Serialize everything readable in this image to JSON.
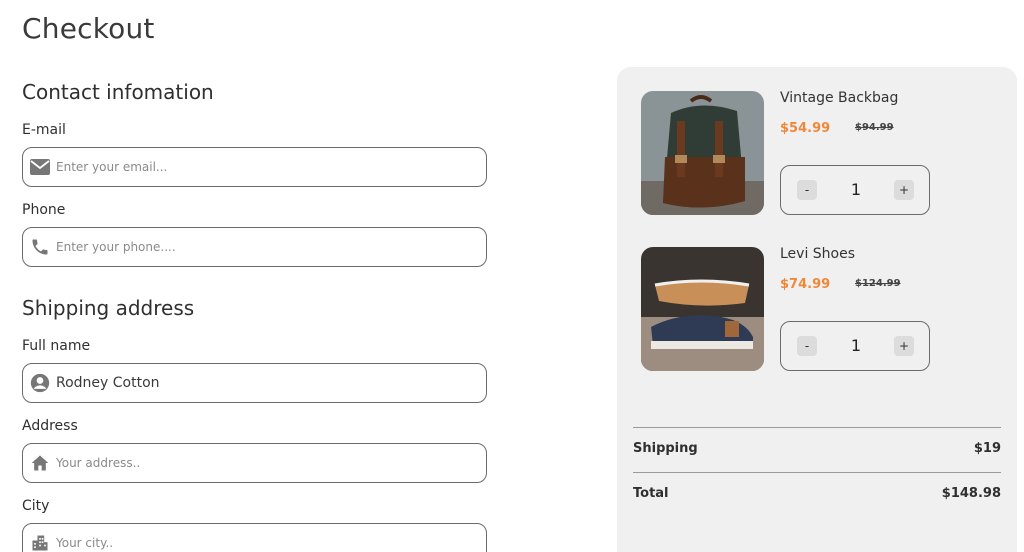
{
  "page": {
    "title": "Checkout"
  },
  "contact": {
    "heading": "Contact infomation",
    "email": {
      "label": "E-mail",
      "placeholder": "Enter your email...",
      "value": ""
    },
    "phone": {
      "label": "Phone",
      "placeholder": "Enter your phone....",
      "value": ""
    }
  },
  "shipping": {
    "heading": "Shipping address",
    "full_name": {
      "label": "Full name",
      "placeholder": "",
      "value": "Rodney Cotton"
    },
    "address": {
      "label": "Address",
      "placeholder": "Your address..",
      "value": ""
    },
    "city": {
      "label": "City",
      "placeholder": "Your city..",
      "value": ""
    }
  },
  "cart": {
    "items": [
      {
        "name": "Vintage Backbag",
        "price": "$54.99",
        "old_price": "$94.99",
        "quantity": "1",
        "minus": "-",
        "plus": "+",
        "image": "backpack-photo"
      },
      {
        "name": "Levi Shoes",
        "price": "$74.99",
        "old_price": "$124.99",
        "quantity": "1",
        "minus": "-",
        "plus": "+",
        "image": "shoes-photo"
      }
    ],
    "shipping_label": "Shipping",
    "shipping_value": "$19",
    "total_label": "Total",
    "total_value": "$148.98"
  },
  "colors": {
    "accent": "#f0883a",
    "panel": "#f0f0f0",
    "border": "#6b6b6b"
  },
  "icons": {
    "email": "mail-icon",
    "phone": "phone-icon",
    "name": "user-icon",
    "address": "home-icon",
    "city": "city-icon"
  }
}
